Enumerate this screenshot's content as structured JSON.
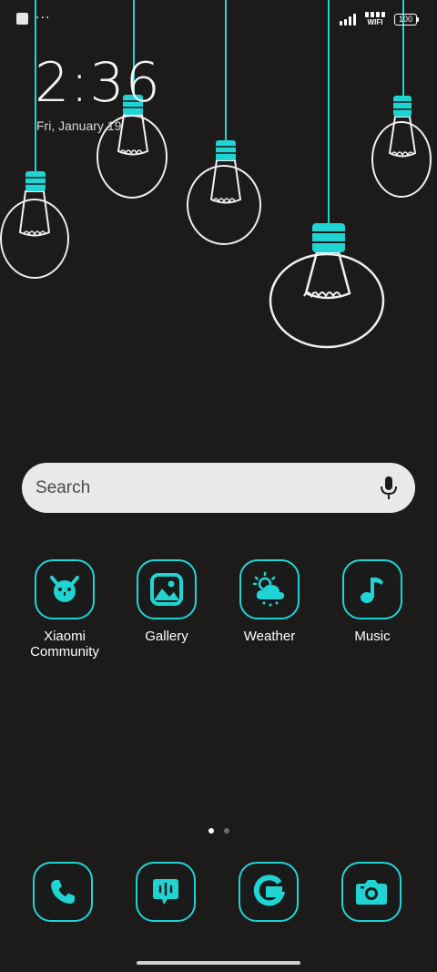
{
  "status_bar": {
    "notification_icons": [
      "square-notification-icon",
      "more-dots-icon"
    ],
    "more_glyph": "···",
    "wifi_label": "WIFI",
    "battery_level": "100"
  },
  "lockscreen_clock": {
    "time": "2:36",
    "date": "Fri, January 19"
  },
  "search": {
    "placeholder": "Search",
    "icon": "mic-icon"
  },
  "apps": [
    {
      "label": "Xiaomi\nCommunity",
      "icon": "xiaomi-community-icon"
    },
    {
      "label": "Gallery",
      "icon": "gallery-icon"
    },
    {
      "label": "Weather",
      "icon": "weather-icon"
    },
    {
      "label": "Music",
      "icon": "music-icon"
    }
  ],
  "page_indicator": {
    "pages": 2,
    "current": 1
  },
  "dock": [
    {
      "icon": "phone-icon"
    },
    {
      "icon": "messages-icon"
    },
    {
      "icon": "google-icon"
    },
    {
      "icon": "camera-icon"
    }
  ],
  "colors": {
    "background": "#1d1a1a",
    "accent": "#21d4d4",
    "bulb_outline": "#f0f0f0",
    "search_bg": "#e9e9e9"
  }
}
